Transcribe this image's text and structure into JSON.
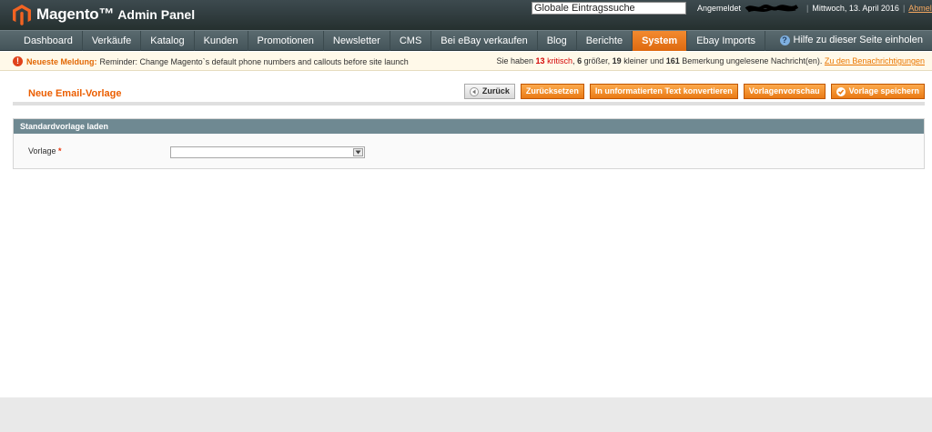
{
  "header": {
    "brand": "Magento",
    "brand_sub": "Admin Panel",
    "search_value": "Globale Eintragssuche",
    "logged_in_label": "Angemeldet",
    "date": "Mittwoch, 13. April 2016",
    "logout": "Abmelden"
  },
  "nav": {
    "items": [
      {
        "label": "Dashboard"
      },
      {
        "label": "Verkäufe"
      },
      {
        "label": "Katalog"
      },
      {
        "label": "Kunden"
      },
      {
        "label": "Promotionen"
      },
      {
        "label": "Newsletter"
      },
      {
        "label": "CMS"
      },
      {
        "label": "Bei eBay verkaufen"
      },
      {
        "label": "Blog"
      },
      {
        "label": "Berichte"
      },
      {
        "label": "System"
      },
      {
        "label": "Ebay Imports"
      }
    ],
    "active_index": 10,
    "help": "Hilfe zu dieser Seite einholen"
  },
  "notice": {
    "label": "Neueste Meldung:",
    "message": "Reminder: Change Magento`s default phone numbers and callouts before site launch",
    "prefix": "Sie haben",
    "critical_count": "13",
    "critical_word": "kritisch",
    "major_count": "6",
    "major_word": "größer,",
    "minor_count": "19",
    "minor_word": "kleiner und",
    "notice_count": "161",
    "suffix": "Bemerkung ungelesene Nachricht(en).",
    "link": "Zu den Benachrichtigungen"
  },
  "page": {
    "title": "Neue Email-Vorlage",
    "buttons": {
      "back": "Zurück",
      "reset": "Zurücksetzen",
      "convert": "In unformatierten Text konvertieren",
      "preview": "Vorlagenvorschau",
      "save": "Vorlage speichern"
    }
  },
  "section": {
    "title": "Standardvorlage laden",
    "field_label": "Vorlage",
    "required_mark": "*",
    "select_value": ""
  },
  "colors": {
    "accent": "#eb5e00",
    "header_bg": "#2d3b3f",
    "nav_bg": "#4f5f64",
    "section_head": "#6f8992"
  }
}
